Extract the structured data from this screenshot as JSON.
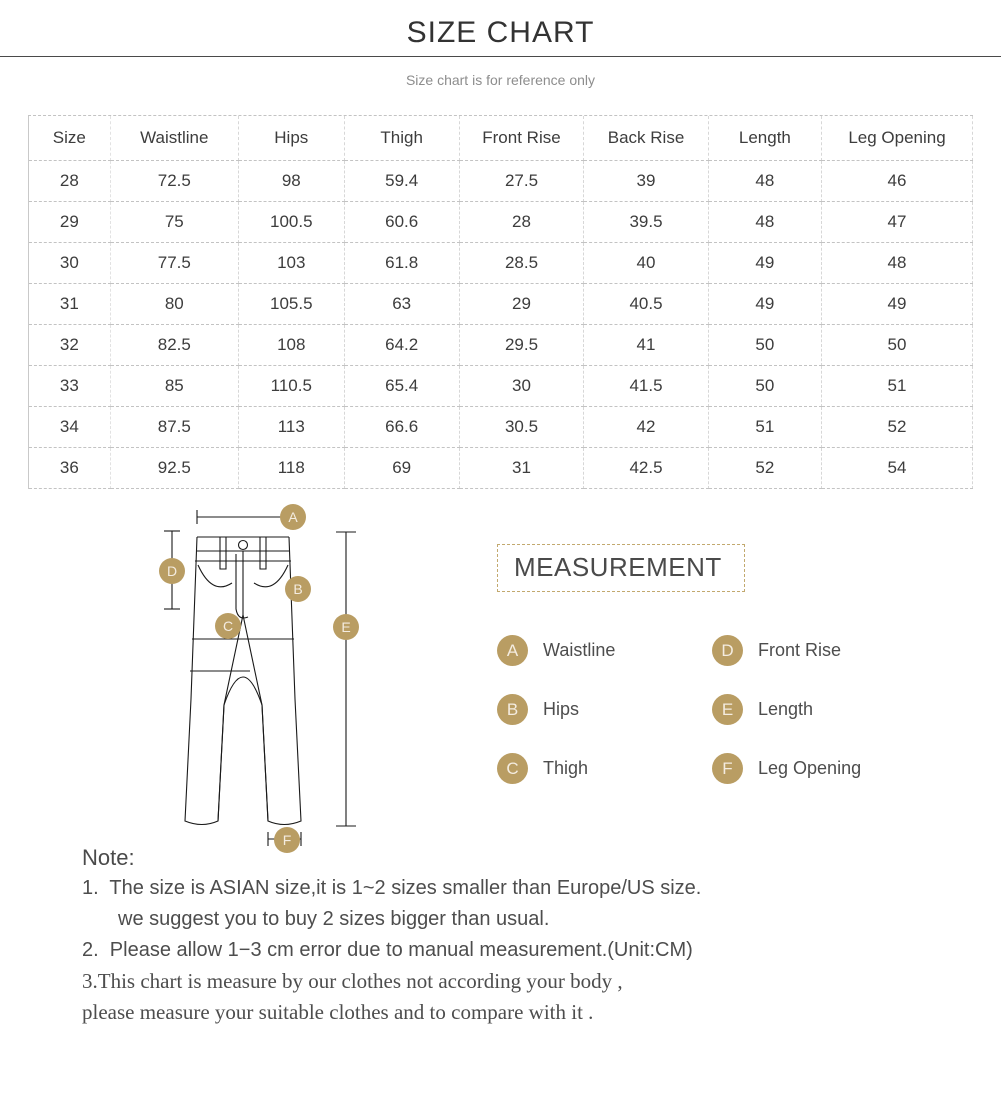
{
  "header": {
    "title": "SIZE CHART",
    "subtitle": "Size chart is for reference only"
  },
  "table": {
    "columns": [
      "Size",
      "Waistline",
      "Hips",
      "Thigh",
      "Front Rise",
      "Back Rise",
      "Length",
      "Leg Opening"
    ],
    "rows": [
      [
        "28",
        "72.5",
        "98",
        "59.4",
        "27.5",
        "39",
        "48",
        "46"
      ],
      [
        "29",
        "75",
        "100.5",
        "60.6",
        "28",
        "39.5",
        "48",
        "47"
      ],
      [
        "30",
        "77.5",
        "103",
        "61.8",
        "28.5",
        "40",
        "49",
        "48"
      ],
      [
        "31",
        "80",
        "105.5",
        "63",
        "29",
        "40.5",
        "49",
        "49"
      ],
      [
        "32",
        "82.5",
        "108",
        "64.2",
        "29.5",
        "41",
        "50",
        "50"
      ],
      [
        "33",
        "85",
        "110.5",
        "65.4",
        "30",
        "41.5",
        "50",
        "51"
      ],
      [
        "34",
        "87.5",
        "113",
        "66.6",
        "30.5",
        "42",
        "51",
        "52"
      ],
      [
        "36",
        "92.5",
        "118",
        "69",
        "31",
        "42.5",
        "52",
        "54"
      ]
    ]
  },
  "diagram": {
    "markers": [
      "A",
      "B",
      "C",
      "D",
      "E",
      "F"
    ]
  },
  "legend": {
    "heading": "MEASUREMENT",
    "items": [
      {
        "key": "A",
        "label": "Waistline"
      },
      {
        "key": "D",
        "label": "Front Rise"
      },
      {
        "key": "B",
        "label": "Hips"
      },
      {
        "key": "E",
        "label": "Length"
      },
      {
        "key": "C",
        "label": "Thigh"
      },
      {
        "key": "F",
        "label": "Leg Opening"
      }
    ]
  },
  "notes": {
    "heading": "Note:",
    "line1a": "1.  The size is ASIAN size,it is 1~2 sizes smaller than Europe/US size.",
    "line1b": "we suggest you to buy 2 sizes bigger than usual.",
    "line2": "2.  Please allow 1−3 cm error due to manual measurement.(Unit:CM)",
    "line3a": "3.This chart is measure by our clothes not according your body ,",
    "line3b": "please measure your suitable clothes and to compare with it ."
  },
  "colors": {
    "badge": "#b99d63",
    "box_border": "#c2a96f",
    "text": "#4d4d4d"
  }
}
